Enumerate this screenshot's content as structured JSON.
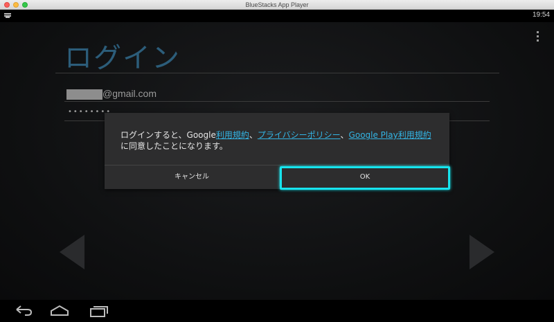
{
  "window": {
    "title": "BlueStacks App Player"
  },
  "statusbar": {
    "time": "19:54"
  },
  "login": {
    "title": "ログイン",
    "email_domain": "@gmail.com",
    "password_dots": "••••••••"
  },
  "dialog": {
    "msg_part1": "ログインすると、Google",
    "link_terms": "利用規約",
    "sep1": "、",
    "link_privacy": "プライバシーポリシー",
    "sep2": "、",
    "link_play_terms": "Google Play利用規約",
    "msg_part2": "に同意したことになります。",
    "cancel_label": "キャンセル",
    "ok_label": "OK"
  },
  "colors": {
    "accent": "#33b5e5",
    "title": "#2c5d7a",
    "highlight": "#17e4ee"
  },
  "navbar": {
    "icons": [
      "back-icon",
      "home-icon",
      "recent-apps-icon"
    ]
  }
}
